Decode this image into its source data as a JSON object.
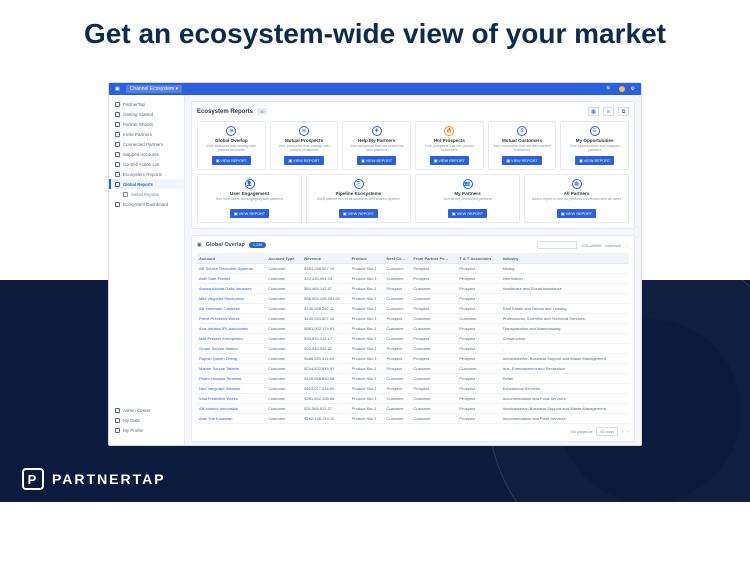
{
  "headline": "Get an ecosystem-wide view of your market",
  "brand": "PARTNERTAP",
  "topbar": {
    "logo": "P",
    "dropdown": "Channel Ecosystem ▾"
  },
  "sidebar": {
    "items": [
      {
        "label": "PartnerTap"
      },
      {
        "label": "Getting Started"
      },
      {
        "label": "Partner Sheets"
      },
      {
        "label": "Invite Partners"
      },
      {
        "label": "Connected Partners"
      },
      {
        "label": "Mapped Accounts"
      },
      {
        "label": "Co-Sell Action List"
      },
      {
        "label": "Ecosystem Reports",
        "sub": [
          {
            "label": "Global Reports",
            "active": true
          },
          {
            "label": "Saved Reports"
          }
        ]
      },
      {
        "label": "Ecosystem Dashboard"
      }
    ],
    "bottom": [
      {
        "label": "Admin Center"
      },
      {
        "label": "My Data"
      },
      {
        "label": "My Profile"
      }
    ]
  },
  "reports": {
    "title": "Ecosystem Reports",
    "badge": "10",
    "view_label": "VIEW REPORT",
    "row1": [
      {
        "icon": "⊕",
        "icon_class": "",
        "title": "Global Overlap",
        "desc": "Your accounts that overlap with partner accounts"
      },
      {
        "icon": "⊕",
        "icon_class": "",
        "title": "Mutual Prospects",
        "desc": "Your prospects that overlap with partner prospects"
      },
      {
        "icon": "✚",
        "icon_class": "",
        "title": "Help My Partners",
        "desc": "Your prospects that are owned by your partners"
      },
      {
        "icon": "🔥",
        "icon_class": "orange",
        "title": "Hot Prospects",
        "desc": "Your prospects that are partner customers"
      },
      {
        "icon": "$",
        "icon_class": "",
        "title": "Mutual Customers",
        "desc": "Your customers that are also partner customers"
      },
      {
        "icon": "☰",
        "icon_class": "",
        "title": "My Opportunities",
        "desc": "Your opportunities with mapped partners"
      }
    ],
    "row2": [
      {
        "icon": "👤",
        "icon_class": "",
        "title": "User Engagement",
        "desc": "See how users are engaging with partners"
      },
      {
        "icon": "⎘",
        "icon_class": "",
        "title": "Pipeline Ecosystems",
        "desc": "Multi-partner mix of all accounts and shared pipeline"
      },
      {
        "icon": "👥",
        "icon_class": "",
        "title": "My Partners",
        "desc": "See all my connected partners"
      },
      {
        "icon": "▦",
        "icon_class": "",
        "title": "All Partners",
        "desc": "Admin report to see all partners connected with all users"
      }
    ]
  },
  "table": {
    "title": "Global Overlap",
    "count": "1,234",
    "search_placeholder": "",
    "columns_label": "COLUMNS",
    "interface_label": "Interface",
    "more_icon": "⋮",
    "headers": [
      "Account",
      "Account Type",
      "Revenue",
      "Product",
      "Next Co...",
      "From Partner Pe...",
      "T & T Associates",
      "Industry"
    ],
    "rows": [
      [
        "AB Source Resource Systems",
        "Customer",
        "$353,248,527.19",
        "Product Sku 1",
        "Customer",
        "Prospect",
        "Prospect",
        "Mining"
      ],
      [
        "Adel Safe Predict",
        "Customer",
        "$22,430,994.33",
        "Product Sku 1",
        "Customer",
        "Prospect",
        "Prospect",
        "Information"
      ],
      [
        "Aurora Akshat Galla Ventures",
        "Customer",
        "$64,469,142.87",
        "Product Sku 1",
        "Prospect",
        "Customer",
        "Prospect",
        "Healthcare and Social Assistance"
      ],
      [
        "Mild Vibgadra Electronics",
        "Customer",
        "$36,083,108,651.33",
        "Product Sku 1",
        "Customer",
        "Customer",
        "Prospect",
        "-"
      ],
      [
        "AB Intramark Captures",
        "Customer",
        "$746,638,242.11",
        "Product Sku 1",
        "Customer",
        "Prospect",
        "Prospect",
        "Real Estate and Rental and Leasing"
      ],
      [
        "Preve Preskens Works",
        "Customer",
        "$159,053,807.16",
        "Product Sku 1",
        "Prospect",
        "Customer",
        "Customer",
        "Professional, Scientific and Technical Services"
      ],
      [
        "Axis Infralek IPL Associates",
        "Customer",
        "$981,002,174.81",
        "Product Sku 1",
        "Customer",
        "Customer",
        "Prospect",
        "Transportation and Warehousing"
      ],
      [
        "Mali Preserv Enterprises",
        "Customer",
        "$34,633,215.17",
        "Product Sku 1",
        "Customer",
        "Prospect",
        "Prospect",
        "Construction"
      ],
      [
        "Scope Source Station",
        "Customer",
        "$23,545,939.82",
        "Product Sku 1",
        "Prospect",
        "Customer",
        "Prospect",
        "-"
      ],
      [
        "Rajesh Queen Zheng",
        "Customer",
        "$486,520,411.80",
        "Product Sku 1",
        "Prospect",
        "Prospect",
        "Prospect",
        "Administrative, Business Support and Waste Management"
      ],
      [
        "Marine Source Tablets",
        "Customer",
        "$204,332,534.57",
        "Product Sku 1",
        "Prospect",
        "Customer",
        "Customer",
        "Arts, Entertainment and Recreation"
      ],
      [
        "Pedro Houssin Terminal",
        "Customer",
        "$128,586,880.88",
        "Product Sku 1",
        "Customer",
        "Customer",
        "Prospect",
        "Retail"
      ],
      [
        "Neo Vanguard Viewess",
        "Customer",
        "$522,077,016.60",
        "Product Sku 1",
        "Prospect",
        "Prospect",
        "Prospect",
        "Educational Services"
      ],
      [
        "Vital Predictive Works",
        "Customer",
        "$281,842,108.88",
        "Product Sku 1",
        "Customer",
        "Customer",
        "Prospect",
        "Accommodation and Food Services"
      ],
      [
        "AB Indirect Innovation",
        "Customer",
        "$91,589,812.37",
        "Product Sku 1",
        "Customer",
        "Customer",
        "Prospect",
        "Administrative, Business Support and Waste Management"
      ],
      [
        "Adel Yue Kushwan",
        "Customer",
        "$262,198,749.10",
        "Product Sku 1",
        "Customer",
        "Customer",
        "Prospect",
        "Accommodation and Food Services"
      ]
    ],
    "pager": {
      "label": "50 pages of",
      "per": "50 rows"
    }
  }
}
